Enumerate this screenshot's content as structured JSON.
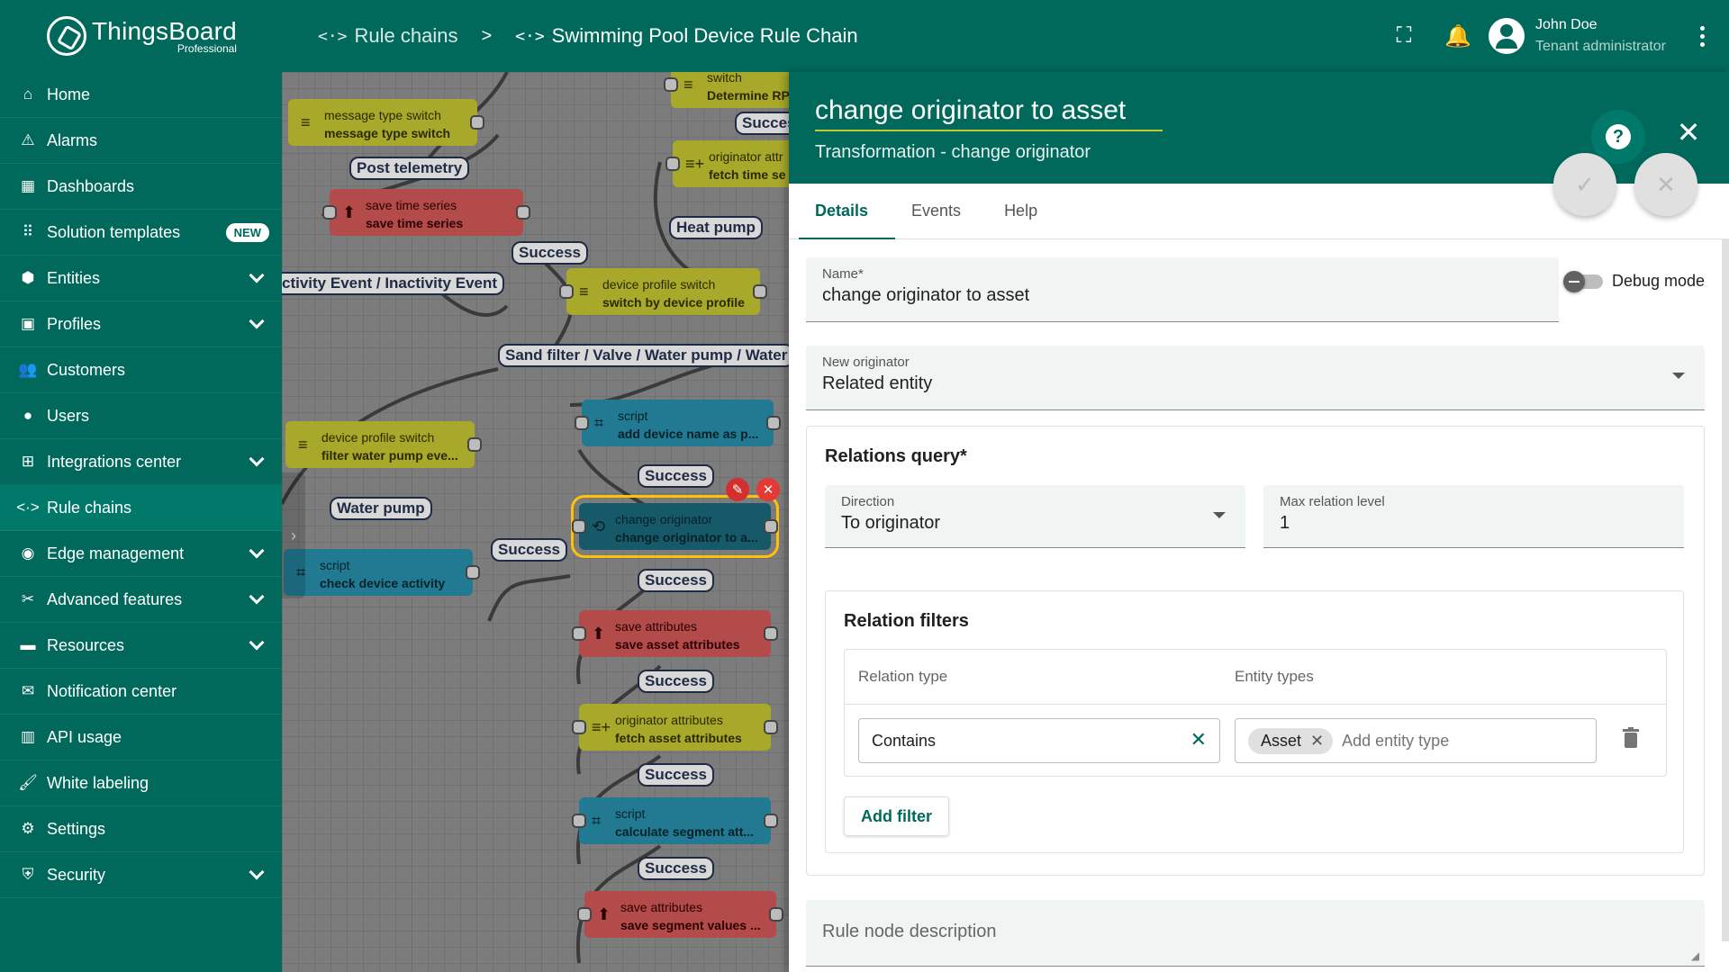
{
  "logo": {
    "brand": "ThingsBoard",
    "edition": "Professional"
  },
  "sidebar": {
    "items": [
      {
        "label": "Home",
        "icon": "⌂"
      },
      {
        "label": "Alarms",
        "icon": "⚠"
      },
      {
        "label": "Dashboards",
        "icon": "▦"
      },
      {
        "label": "Solution templates",
        "icon": "⠿",
        "badge": "NEW"
      },
      {
        "label": "Entities",
        "icon": "⬢"
      },
      {
        "label": "Profiles",
        "icon": "▣"
      },
      {
        "label": "Customers",
        "icon": "👥"
      },
      {
        "label": "Users",
        "icon": "●"
      },
      {
        "label": "Integrations center",
        "icon": "⊞"
      },
      {
        "label": "Rule chains",
        "icon": "<·>"
      },
      {
        "label": "Edge management",
        "icon": "◉"
      },
      {
        "label": "Advanced features",
        "icon": "✂"
      },
      {
        "label": "Resources",
        "icon": "▬"
      },
      {
        "label": "Notification center",
        "icon": "✉"
      },
      {
        "label": "API usage",
        "icon": "▥"
      },
      {
        "label": "White labeling",
        "icon": "🖌"
      },
      {
        "label": "Settings",
        "icon": "⚙"
      },
      {
        "label": "Security",
        "icon": "⛨"
      }
    ]
  },
  "header": {
    "breadcrumb": [
      "Rule chains",
      "Swimming Pool Device Rule Chain"
    ],
    "breadcrumb_separator": ">",
    "user": {
      "name": "John Doe",
      "role": "Tenant administrator"
    }
  },
  "canvas": {
    "nodes": [
      {
        "type": "switch",
        "name": "Determine RP",
        "color": "yellow"
      },
      {
        "type": "message type switch",
        "name": "message type switch",
        "color": "yellow"
      },
      {
        "type": "originator attr",
        "name": "fetch time se",
        "color": "yellow"
      },
      {
        "type": "save time series",
        "name": "save time series",
        "color": "red"
      },
      {
        "type": "device profile switch",
        "name": "switch by device profile",
        "color": "yellow"
      },
      {
        "type": "script",
        "name": "add device name as p...",
        "color": "teal"
      },
      {
        "type": "device profile switch",
        "name": "filter water pump eve...",
        "color": "yellow"
      },
      {
        "type": "change originator",
        "name": "change originator to a...",
        "color": "teal"
      },
      {
        "type": "script",
        "name": "check device activity",
        "color": "teal"
      },
      {
        "type": "save attributes",
        "name": "save asset attributes",
        "color": "red"
      },
      {
        "type": "originator attributes",
        "name": "fetch asset attributes",
        "color": "yellow"
      },
      {
        "type": "script",
        "name": "calculate segment att...",
        "color": "teal"
      },
      {
        "type": "save attributes",
        "name": "save segment values ...",
        "color": "red"
      }
    ],
    "labels": [
      "Succes",
      "Post telemetry",
      "Heat pump",
      "Success",
      "ctivity Event / Inactivity Event",
      "Sand filter / Valve / Water pump / Water",
      "Success",
      "Water pump",
      "Success",
      "Success",
      "Success",
      "Success",
      "Success"
    ]
  },
  "panel": {
    "title": "change originator to asset",
    "subtitle": "Transformation - change originator",
    "tabs": [
      "Details",
      "Events",
      "Help"
    ],
    "name_label": "Name*",
    "name_value": "change originator to asset",
    "debug_label": "Debug mode",
    "originator_label": "New originator",
    "originator_value": "Related entity",
    "relations_title": "Relations query*",
    "direction_label": "Direction",
    "direction_value": "To originator",
    "max_level_label": "Max relation level",
    "max_level_value": "1",
    "filters_title": "Relation filters",
    "col_relation_type": "Relation type",
    "col_entity_types": "Entity types",
    "relation_type_value": "Contains",
    "entity_chip": "Asset",
    "entity_placeholder": "Add entity type",
    "add_filter_label": "Add filter",
    "description_placeholder": "Rule node description"
  }
}
